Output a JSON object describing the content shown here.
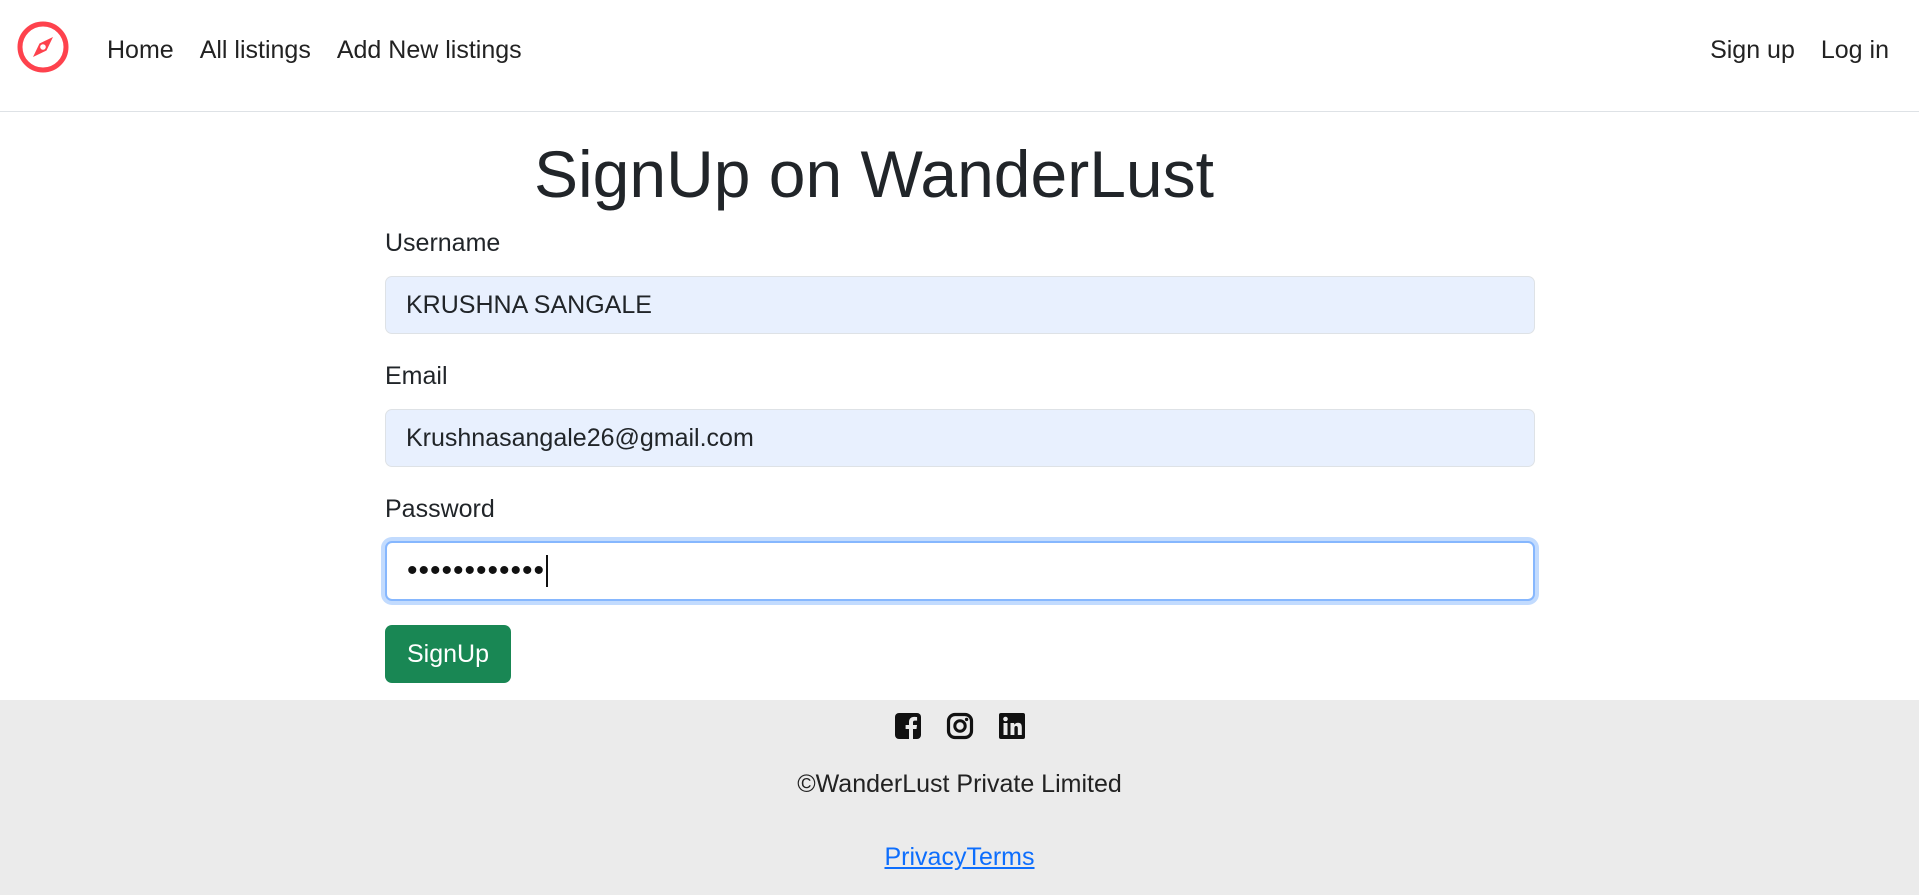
{
  "nav": {
    "brand_icon": "compass-icon",
    "brand_color": "#fe424d",
    "links": [
      "Home",
      "All listings",
      "Add New listings"
    ],
    "right_links": [
      "Sign up",
      "Log in"
    ]
  },
  "main": {
    "title": "SignUp on WanderLust",
    "username_label": "Username",
    "username_value": "KRUSHNA SANGALE",
    "email_label": "Email",
    "email_value": "Krushnasangale26@gmail.com",
    "password_label": "Password",
    "password_masked": "••••••••••••",
    "submit_label": "SignUp",
    "submit_color": "#198754"
  },
  "footer": {
    "social_icons": [
      "facebook-icon",
      "instagram-icon",
      "linkedin-icon"
    ],
    "copyright": "©WanderLust Private Limited",
    "link_privacy": "Privacy",
    "link_terms": "Terms",
    "background": "#ebebeb"
  }
}
